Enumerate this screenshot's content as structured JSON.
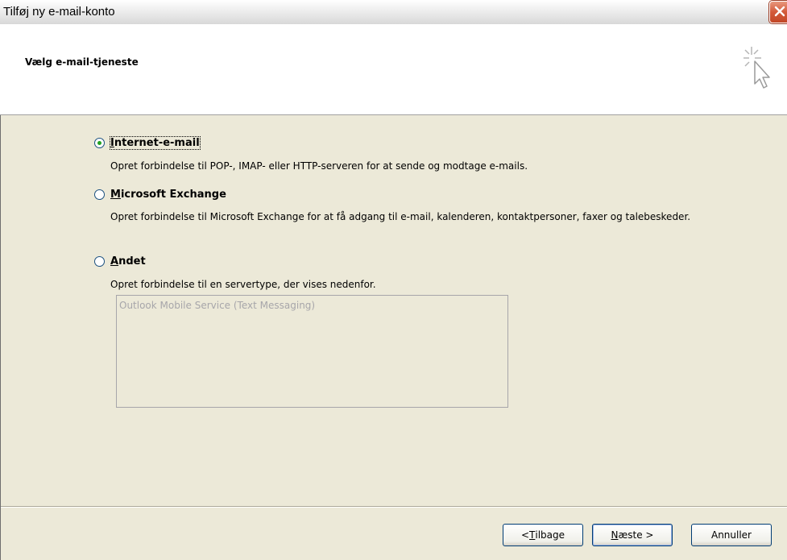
{
  "window": {
    "title": "Tilføj ny e-mail-konto"
  },
  "header": {
    "title": "Vælg e-mail-tjeneste",
    "icon": "wizard-cursor-icon"
  },
  "options": [
    {
      "label": "Internet-e-mail",
      "accel": "I",
      "rest": "nternet-e-mail",
      "checked": true,
      "description": "Opret forbindelse til POP-, IMAP- eller HTTP-serveren for at sende og modtage e-mails."
    },
    {
      "label": "Microsoft Exchange",
      "accel": "M",
      "rest": "icrosoft Exchange",
      "checked": false,
      "description": "Opret forbindelse til Microsoft Exchange for at få adgang til e-mail, kalenderen, kontaktpersoner, faxer og talebeskeder."
    },
    {
      "label": "Andet",
      "accel": "A",
      "rest": "ndet",
      "checked": false,
      "description": "Opret forbindelse til en servertype, der vises nedenfor."
    }
  ],
  "other_services": {
    "items": [
      "Outlook Mobile Service (Text Messaging)"
    ]
  },
  "buttons": {
    "back": {
      "prefix": "< ",
      "accel": "T",
      "rest": "ilbage"
    },
    "next": {
      "prefix": "",
      "accel": "N",
      "rest": "æste >"
    },
    "cancel": {
      "label": "Annuller"
    }
  },
  "colors": {
    "close_button": "#d35a3a",
    "radio_dot": "#21a121",
    "background": "#ece9d8"
  }
}
